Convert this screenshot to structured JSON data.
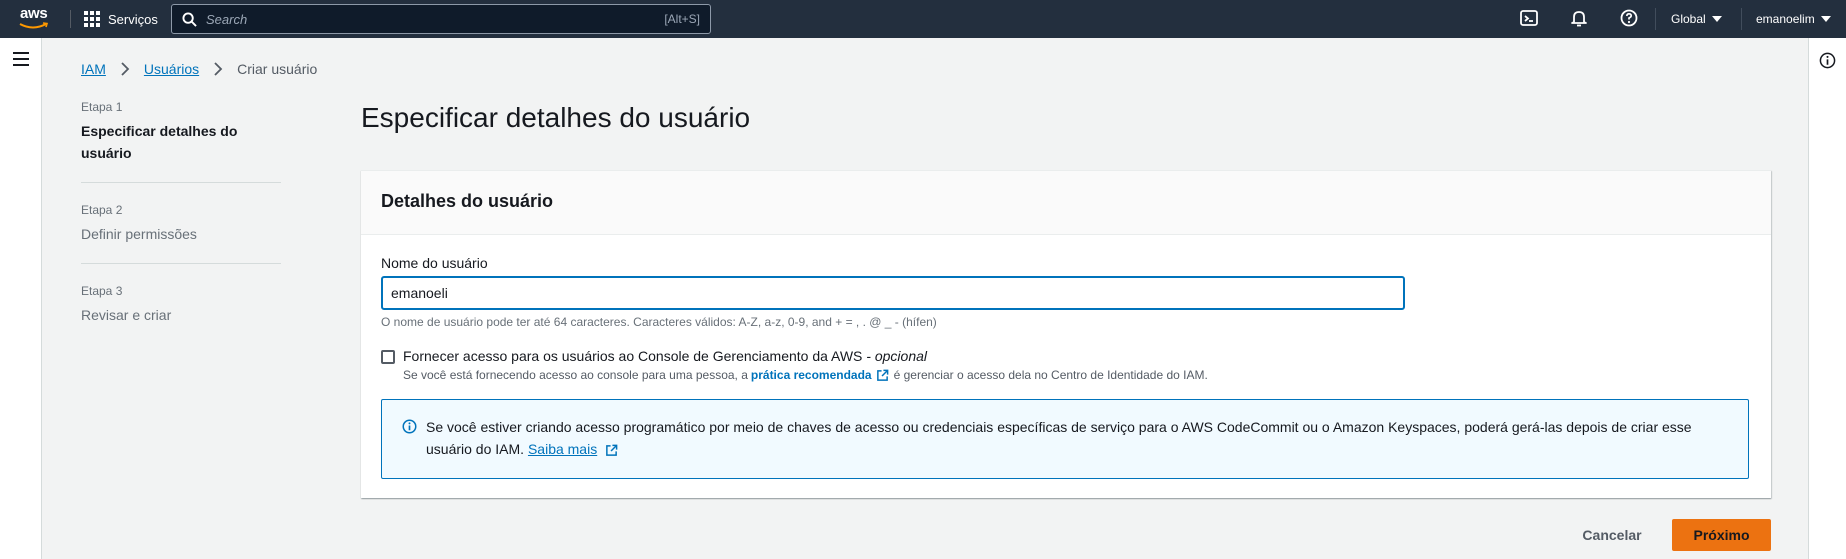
{
  "topnav": {
    "logo": "aws",
    "services_label": "Serviços",
    "search_placeholder": "Search",
    "search_shortcut": "[Alt+S]",
    "icons": [
      "cloudshell-icon",
      "notifications-icon",
      "help-icon"
    ],
    "region_label": "Global",
    "user_label": "emanoelim"
  },
  "breadcrumb": {
    "items": [
      {
        "label": "IAM"
      },
      {
        "label": "Usuários"
      }
    ],
    "current": "Criar usuário"
  },
  "steps": [
    {
      "number": "Etapa 1",
      "title": "Especificar detalhes do usuário",
      "active": true
    },
    {
      "number": "Etapa 2",
      "title": "Definir permissões",
      "active": false
    },
    {
      "number": "Etapa 3",
      "title": "Revisar e criar",
      "active": false
    }
  ],
  "page": {
    "title": "Especificar detalhes do usuário"
  },
  "container": {
    "header": "Detalhes do usuário",
    "username_label": "Nome do usuário",
    "username_value": "emanoeli",
    "username_hint": "O nome de usuário pode ter até 64 caracteres. Caracteres válidos: A-Z, a-z, 0-9, and + = , . @ _ - (hífen)",
    "console_access_label": "Fornecer acesso para os usuários ao Console de Gerenciamento da AWS",
    "console_access_optional": "- opcional",
    "console_access_desc_pre": "Se você está fornecendo acesso ao console para uma pessoa, a",
    "console_access_desc_link": "prática recomendada",
    "console_access_desc_post": "é gerenciar o acesso dela no Centro de Identidade do IAM.",
    "console_access_checked": false
  },
  "info_alert": {
    "text": "Se você estiver criando acesso programático por meio de chaves de acesso ou credenciais específicas de serviço para o AWS CodeCommit ou o Amazon Keyspaces, poderá gerá-las depois de criar esse usuário do IAM.",
    "link": "Saiba mais"
  },
  "footer": {
    "cancel_label": "Cancelar",
    "next_label": "Próximo"
  },
  "colors": {
    "nav_bg": "#232f3e",
    "link": "#0073bb",
    "primary_button": "#ec7211",
    "page_bg": "#f2f3f3"
  }
}
